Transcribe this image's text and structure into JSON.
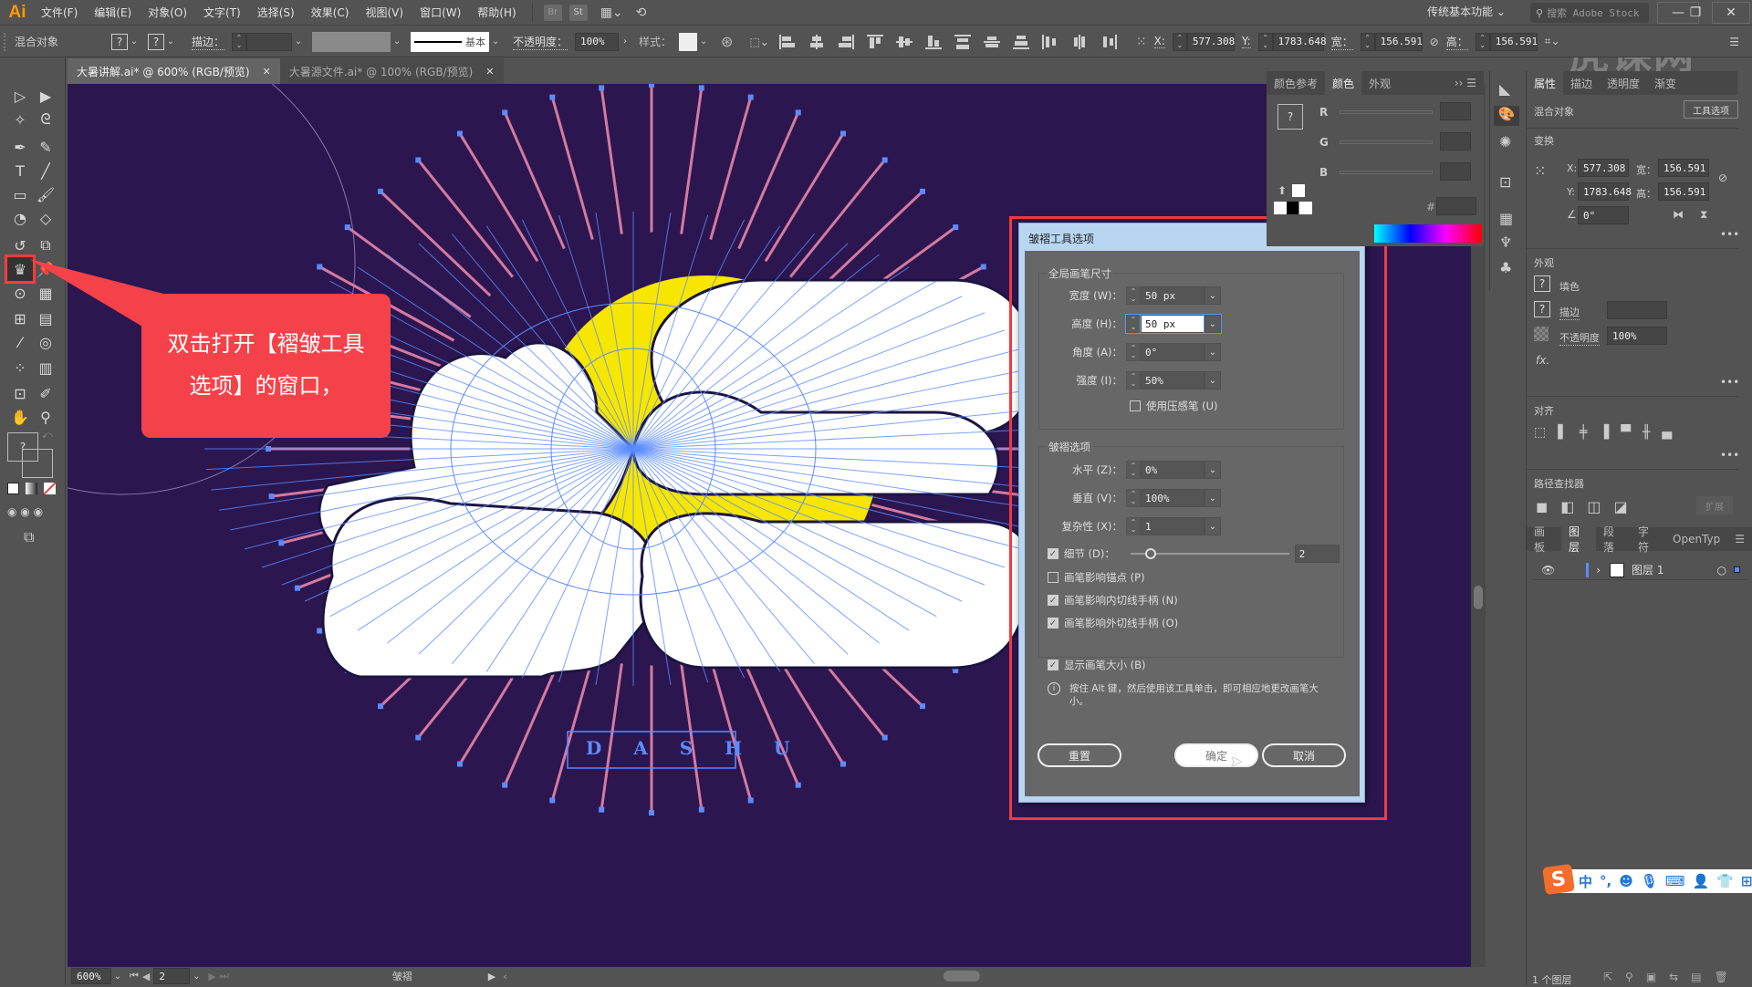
{
  "app": {
    "logo": "Ai"
  },
  "menu": [
    "文件(F)",
    "编辑(E)",
    "对象(O)",
    "文字(T)",
    "选择(S)",
    "效果(C)",
    "视图(V)",
    "窗口(W)",
    "帮助(H)"
  ],
  "menu_badges": [
    "Br",
    "St"
  ],
  "workspace": "传统基本功能",
  "stock_search": {
    "placeholder": "搜索 Adobe Stock"
  },
  "window_buttons": {
    "minimize": "—",
    "restore": "❐",
    "close": "✕"
  },
  "control_bar": {
    "selection_label": "混合对象",
    "fill": "?",
    "stroke": "?",
    "stroke_label": "描边：",
    "stroke_profile": "基本",
    "opacity_label": "不透明度：",
    "opacity": "100%",
    "style_label": "样式：",
    "x_label": "X:",
    "x": "577.308",
    "y_label": "Y:",
    "y": "1783.648",
    "w_label": "宽：",
    "w": "156.591",
    "h_label": "高：",
    "h": "156.591"
  },
  "doc_tabs": [
    {
      "label": "大暑讲解.ai* @ 600% (RGB/预览)",
      "active": true
    },
    {
      "label": "大暑源文件.ai* @ 100% (RGB/预览)",
      "active": false
    }
  ],
  "tools": {
    "selected": "wrinkle-tool"
  },
  "callout": {
    "line1": "双击打开【褶皱工具",
    "line2": "选项】的窗口，"
  },
  "artwork": {
    "text": "D A S H U",
    "bg_color": "#2c1650",
    "ray_color": "#d47aa0",
    "sun_color": "#f7e600",
    "cloud_color": "#ffffff",
    "path_color": "#5b8cff"
  },
  "dialog": {
    "title": "皱褶工具选项",
    "global_brush_title": "全局画笔尺寸",
    "width_label": "宽度 (W)：",
    "width": "50 px",
    "height_label": "高度 (H)：",
    "height": "50 px",
    "angle_label": "角度 (A)：",
    "angle": "0°",
    "intensity_label": "强度 (I)：",
    "intensity": "50%",
    "use_pressure_label": "使用压感笔 (U)",
    "use_pressure": false,
    "wrinkle_options_title": "皱褶选项",
    "horizontal_label": "水平 (Z)：",
    "horizontal": "0%",
    "vertical_label": "垂直 (V)：",
    "vertical": "100%",
    "complexity_label": "复杂性 (X)：",
    "complexity": "1",
    "detail_label": "细节 (D)：",
    "detail_checked": true,
    "detail_value": "2",
    "detail_fraction": 0.1,
    "brush_anchor_label": "画笔影响锚点 (P)",
    "brush_anchor": false,
    "brush_in_label": "画笔影响内切线手柄 (N)",
    "brush_in": true,
    "brush_out_label": "画笔影响外切线手柄 (O)",
    "brush_out": true,
    "show_brush_label": "显示画笔大小 (B)",
    "show_brush": true,
    "info": "按住 Alt 键，然后使用该工具单击，即可相应地更改画笔大小。",
    "reset": "重置",
    "ok": "确定",
    "cancel": "取消"
  },
  "color_panel": {
    "tabs": [
      "颜色参考",
      "颜色",
      "外观"
    ],
    "active_tab": "颜色",
    "channels": [
      "R",
      "G",
      "B"
    ],
    "hex_label": "#"
  },
  "properties_panel": {
    "tabs": [
      "属性",
      "描边",
      "透明度",
      "渐变"
    ],
    "active_tab": "属性",
    "object_type": "混合对象",
    "tool_options_btn": "工具选项",
    "transform_title": "变换",
    "x_label": "X:",
    "x": "577.308",
    "y_label": "Y:",
    "y": "1783.648",
    "w_label": "宽：",
    "w": "156.591",
    "h_label": "高：",
    "h": "156.591",
    "angle": "0°",
    "appearance_title": "外观",
    "fill_label": "填色",
    "stroke_label": "描边",
    "opacity_label": "不透明度",
    "opacity": "100%",
    "fx": "fx.",
    "align_title": "对齐",
    "pathfinder_title": "路径查找器",
    "expand": "扩展"
  },
  "layers_panel": {
    "tabs": [
      "画板",
      "图层",
      "段落",
      "字符",
      "OpenTyp"
    ],
    "active_tab": "图层",
    "layers": [
      {
        "name": "图层 1",
        "visible": true
      }
    ],
    "footer_count": "1 个图层"
  },
  "status_bar": {
    "zoom": "600%",
    "artboard": "2",
    "tool_name": "皱褶"
  },
  "ime": {
    "mode": "中",
    "punct": "°,"
  },
  "watermark": "虎课网"
}
